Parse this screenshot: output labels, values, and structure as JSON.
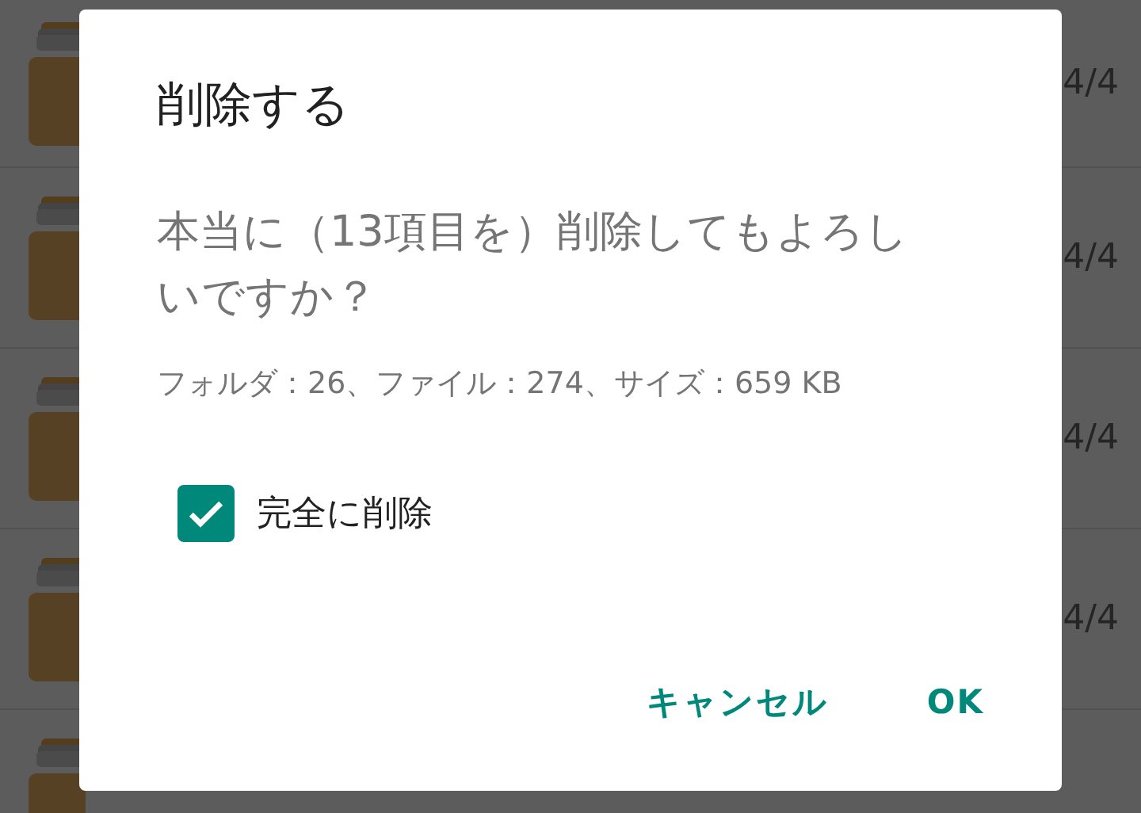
{
  "background_list": {
    "rows": [
      {
        "kind": "folder",
        "count": "4/4"
      },
      {
        "kind": "folder",
        "count": "4/4"
      },
      {
        "kind": "folder",
        "count": "4/4"
      },
      {
        "kind": "folder",
        "count": "4/4"
      },
      {
        "kind": "folder"
      }
    ]
  },
  "dialog": {
    "title": "削除する",
    "message": "本当に（13項目を）削除してもよろしいですか？",
    "details": "フォルダ：26、ファイル：274、サイズ：659 KB",
    "option": {
      "label": "完全に削除",
      "checked": true
    },
    "buttons": [
      {
        "label": "キャンセル"
      },
      {
        "label": "OK"
      }
    ]
  }
}
